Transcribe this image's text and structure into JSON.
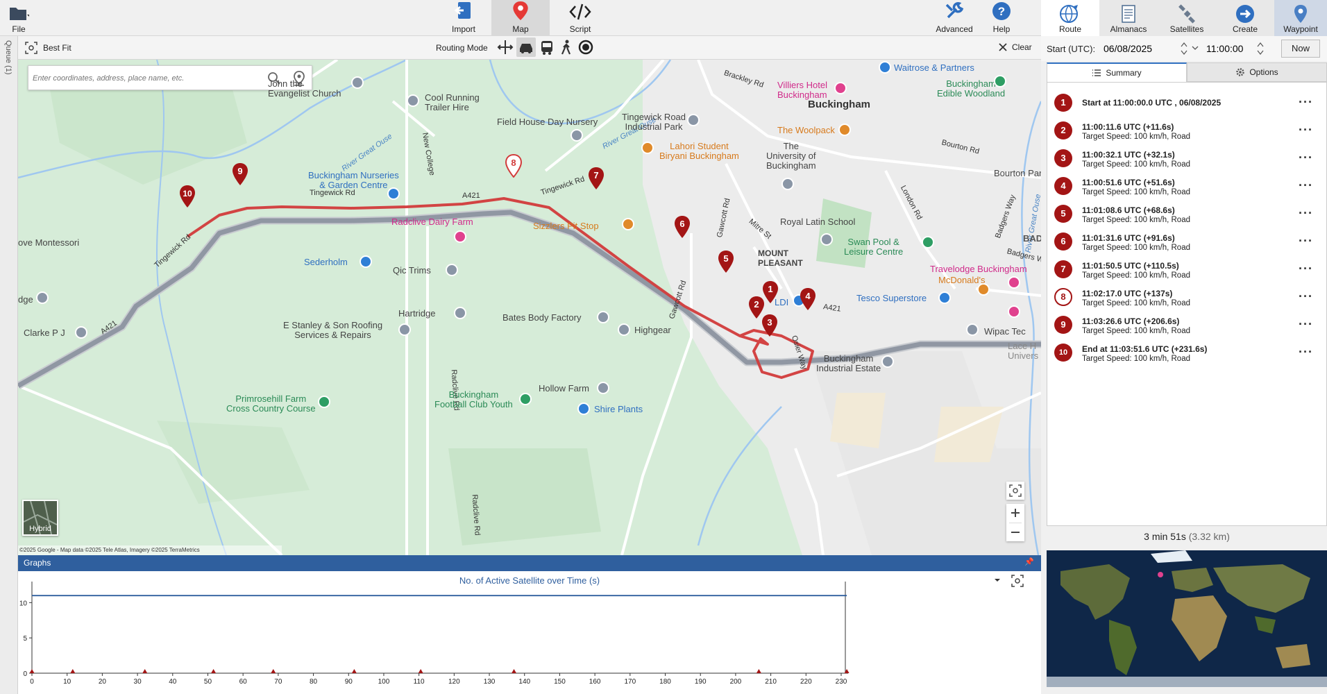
{
  "toolbar": {
    "file_label": "File",
    "import_label": "Import",
    "map_label": "Map",
    "script_label": "Script",
    "advanced_label": "Advanced",
    "help_label": "Help"
  },
  "queue_label": "Queue (1)",
  "mapbar": {
    "best_fit_label": "Best Fit",
    "routing_mode_label": "Routing Mode",
    "clear_label": "Clear"
  },
  "search": {
    "placeholder": "Enter coordinates, address, place name, etc."
  },
  "map": {
    "places": {
      "john_evangelist": "John the\nEvangelist Church",
      "cool_running": "Cool Running\nTrailer Hire",
      "river_great_ouse_1": "River Great Ouse",
      "river_great_ouse_2": "River Great Ouse",
      "river_great_ouse_3": "River Great Ouse",
      "brackley_rd": "Brackley Rd",
      "waitrose": "Waitrose & Partners",
      "villiers": "Villiers Hotel\nBuckingham",
      "buckingham": "Buckingham",
      "edible_woodland": "Buckingham\nEdible Woodland",
      "tingewick_ind": "Tingewick Road\nIndustrial Park",
      "woolpack": "The Woolpack",
      "uni": "The\nUniversity of\nBuckingham",
      "bourton_rd": "Bourton Rd",
      "bourton_park": "Bourton Park",
      "field_house": "Field House Day Nursery",
      "new_college": "New College",
      "lahori": "Lahori Student\nBiryani Buckingham",
      "nurseries": "Buckingham Nurseries\n& Garden Centre",
      "tingewick_rd_1": "Tingewick Rd",
      "tingewick_rd_2": "Tingewick Rd",
      "tingewick_rd_3": "Tingewick Rd",
      "a421_1": "A421",
      "a421_2": "A421",
      "a421_3": "A421",
      "sizzlers": "Sizzlers Pit Stop",
      "mitre_st": "Mitre St",
      "royal_latin": "Royal Latin School",
      "swan_pool": "Swan Pool &\nLeisure Centre",
      "london_rd": "London Rd",
      "badgers_way_1": "Badgers Way",
      "badgers_way_2": "Badgers Way",
      "radclive_dairy": "Radclive Dairy Farm",
      "gawcott_rd_1": "Gawcott Rd",
      "gawcott_rd_2": "Gawcott Rd",
      "mount_pleasant": "MOUNT\nPLEASANT",
      "travelodge": "Travelodge Buckingham",
      "mcdonalds": "McDonald's",
      "montessori": "ove Montessori",
      "sederholm": "Sederholm",
      "qic_trims": "Qic Trims",
      "aldi": "LDI",
      "tesco": "Tesco Superstore",
      "dge": "dge",
      "hartridge": "Hartridge",
      "bates": "Bates Body Factory",
      "highgear": "Highgear",
      "wipac": "Wipac Tec",
      "lace": "Lace H\nUnivers",
      "clarke": "Clarke P J",
      "stanley": "E Stanley & Son Roofing\nServices & Repairs",
      "radclive_rd_1": "Radclive Rd",
      "radclive_rd_2": "Radclive Rd",
      "osier_way": "Osier Way",
      "ind_estate": "Buckingham\nIndustrial Estate",
      "bad": "BAD",
      "hollow_farm": "Hollow Farm",
      "primrosehill": "Primrosehill Farm\nCross Country Course",
      "football": "Buckingham\nFootball Club Youth",
      "shire_plants": "Shire Plants",
      "hybrid": "Hybrid",
      "attribution": "©2025 Google - Map data ©2025 Tele Atlas, Imagery ©2025 TerraMetrics"
    },
    "pins": [
      "1",
      "2",
      "3",
      "4",
      "5",
      "6",
      "7",
      "8",
      "9",
      "10"
    ]
  },
  "graphs": {
    "header": "Graphs",
    "title": "No. of Active Satellite over Time (s)"
  },
  "chart_data": {
    "type": "line",
    "title": "No. of Active Satellite over Time (s)",
    "xlabel": "",
    "ylabel": "",
    "xlim": [
      0,
      231.6
    ],
    "ylim": [
      0,
      12
    ],
    "x_ticks": [
      0,
      10,
      20,
      30,
      40,
      50,
      60,
      70,
      80,
      90,
      100,
      110,
      120,
      130,
      140,
      150,
      160,
      170,
      180,
      190,
      200,
      210,
      220,
      230
    ],
    "y_ticks": [
      0,
      5,
      10
    ],
    "series": [
      {
        "x": [
          0,
          231.6
        ],
        "values": [
          11,
          11
        ]
      }
    ],
    "waypoint_markers": [
      0,
      11.6,
      32.1,
      51.6,
      68.6,
      91.6,
      110.5,
      137,
      206.6,
      231.6
    ]
  },
  "rtabs": {
    "route": "Route",
    "almanacs": "Almanacs",
    "satellites": "Satellites",
    "create": "Create",
    "waypoint": "Waypoint"
  },
  "start": {
    "label": "Start (UTC):",
    "date": "06/08/2025",
    "time": "11:00:00",
    "now": "Now"
  },
  "subtabs": {
    "summary": "Summary",
    "options": "Options"
  },
  "waypoints": [
    {
      "num": "1",
      "l1": "Start at 11:00:00.0 UTC , 06/08/2025",
      "l2": ""
    },
    {
      "num": "2",
      "l1": "11:00:11.6 UTC (+11.6s)",
      "l2": "Target Speed: 100 km/h, Road"
    },
    {
      "num": "3",
      "l1": "11:00:32.1 UTC (+32.1s)",
      "l2": "Target Speed: 100 km/h, Road"
    },
    {
      "num": "4",
      "l1": "11:00:51.6 UTC (+51.6s)",
      "l2": "Target Speed: 100 km/h, Road"
    },
    {
      "num": "5",
      "l1": "11:01:08.6 UTC (+68.6s)",
      "l2": "Target Speed: 100 km/h, Road"
    },
    {
      "num": "6",
      "l1": "11:01:31.6 UTC (+91.6s)",
      "l2": "Target Speed: 100 km/h, Road"
    },
    {
      "num": "7",
      "l1": "11:01:50.5 UTC (+110.5s)",
      "l2": "Target Speed: 100 km/h, Road"
    },
    {
      "num": "8",
      "l1": "11:02:17.0 UTC (+137s)",
      "l2": "Target Speed: 100 km/h, Road"
    },
    {
      "num": "9",
      "l1": "11:03:26.6 UTC (+206.6s)",
      "l2": "Target Speed: 100 km/h, Road"
    },
    {
      "num": "10",
      "l1": "End at 11:03:51.6 UTC (+231.6s)",
      "l2": "Target Speed: 100 km/h, Road"
    }
  ],
  "duration": {
    "time": "3 min 51s",
    "distance": "(3.32 km)"
  },
  "colors": {
    "route": "#d23b3b",
    "pin": "#a31515",
    "accent": "#2f5f9e"
  }
}
